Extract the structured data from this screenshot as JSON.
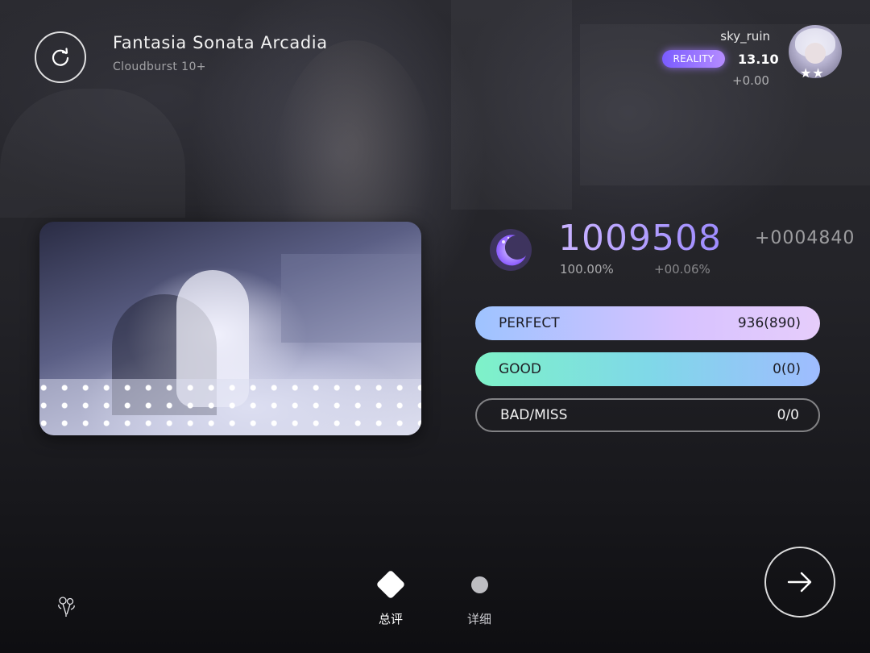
{
  "song": {
    "title": "Fantasia Sonata Arcadia",
    "difficulty": "Cloudburst 10+"
  },
  "player": {
    "name": "sky_ruin",
    "badge": "REALITY",
    "rks": "13.10",
    "rks_delta": "+0.00",
    "avatar_stars": "★★"
  },
  "result": {
    "score": "1009508",
    "score_diff": "+0004840",
    "accuracy": "100.00%",
    "accuracy_diff": "+00.06%"
  },
  "judgements": [
    {
      "label": "PERFECT",
      "value": "936(890)"
    },
    {
      "label": "GOOD",
      "value": "0(0)"
    },
    {
      "label": "BAD/MISS",
      "value": "0/0"
    }
  ],
  "tabs": [
    {
      "label": "总评",
      "active": true
    },
    {
      "label": "详细",
      "active": false
    }
  ],
  "icons": {
    "retry": "retry-icon",
    "next": "arrow-right-icon",
    "rank": "moon-icon",
    "flower": "flower-icon"
  },
  "colors": {
    "score_gradient": [
      "#c9b3ff",
      "#9e8cff"
    ],
    "perfect_gradient": [
      "#9ec3ff",
      "#e6cdfb"
    ],
    "good_gradient": [
      "#7ef2c8",
      "#9fbcff"
    ],
    "badge": "#8a6cff"
  }
}
